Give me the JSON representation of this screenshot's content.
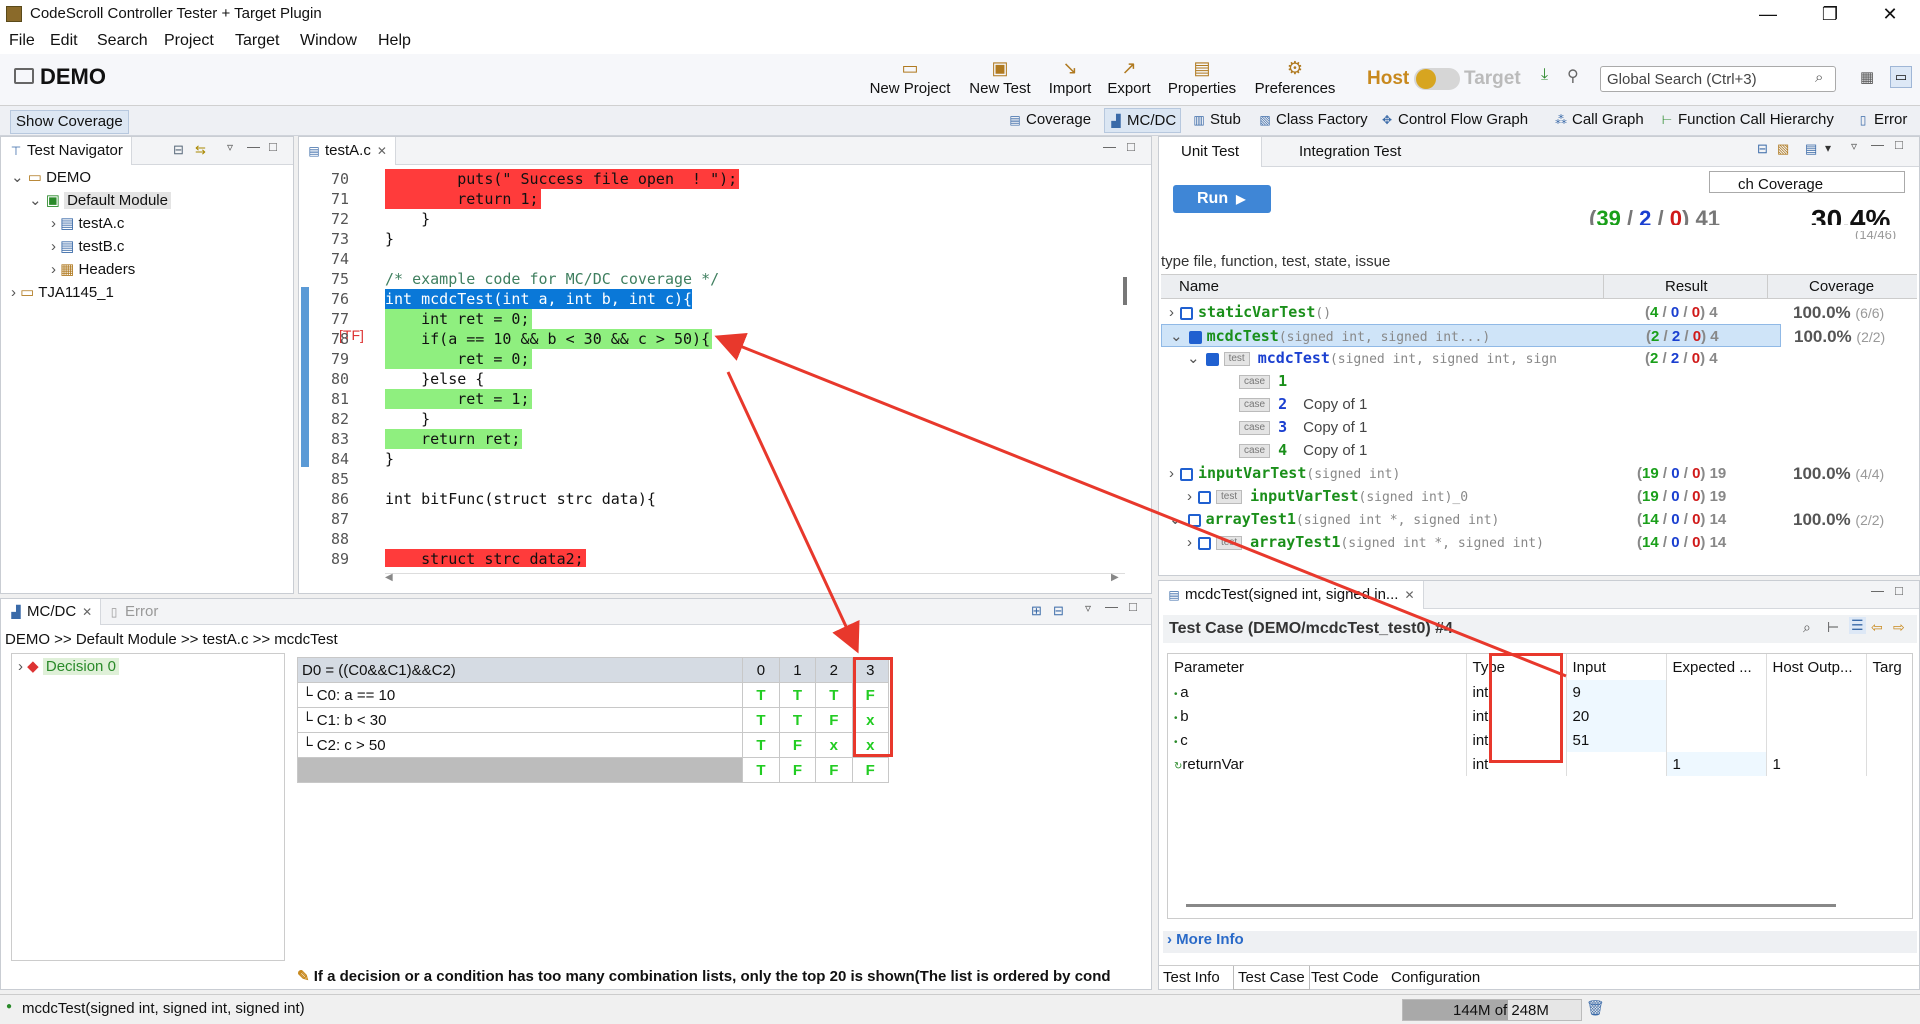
{
  "window": {
    "title": "CodeScroll Controller Tester + Target Plugin",
    "min": "—",
    "max": "❐",
    "close": "✕"
  },
  "menu": [
    "File",
    "Edit",
    "Search",
    "Project",
    "Target",
    "Window",
    "Help"
  ],
  "toolbar": {
    "project": "DEMO",
    "buttons": [
      "New Project",
      "New Test",
      "Import",
      "Export",
      "Properties",
      "Preferences"
    ],
    "host": "Host",
    "target": "Target",
    "search_placeholder": "Global Search (Ctrl+3)"
  },
  "perspective": {
    "show_coverage": "Show Coverage",
    "tabs": [
      "Coverage",
      "MC/DC",
      "Stub",
      "Class Factory",
      "Control Flow Graph",
      "Call Graph",
      "Function Call Hierarchy",
      "Error"
    ]
  },
  "navigator": {
    "title": "Test Navigator",
    "items": [
      "DEMO",
      "Default Module",
      "testA.c",
      "testB.c",
      "Headers",
      "TJA1145_1"
    ]
  },
  "editor": {
    "tab": "testA.c",
    "marker": "[TF]",
    "lines": [
      {
        "n": "70",
        "t": "        puts(\" Success file open  ! \");"
      },
      {
        "n": "71",
        "t": "        return 1;"
      },
      {
        "n": "72",
        "t": "    }"
      },
      {
        "n": "73",
        "t": "}"
      },
      {
        "n": "74",
        "t": ""
      },
      {
        "n": "75",
        "t": "/* example code for MC/DC coverage */"
      },
      {
        "n": "76",
        "t": "int mcdcTest(int a, int b, int c){"
      },
      {
        "n": "77",
        "t": "    int ret = 0;"
      },
      {
        "n": "78",
        "t": "    if(a == 10 && b < 30 && c > 50){"
      },
      {
        "n": "79",
        "t": "        ret = 0;"
      },
      {
        "n": "80",
        "t": "    }else {"
      },
      {
        "n": "81",
        "t": "        ret = 1;"
      },
      {
        "n": "82",
        "t": "    }"
      },
      {
        "n": "83",
        "t": "    return ret;"
      },
      {
        "n": "84",
        "t": "}"
      },
      {
        "n": "85",
        "t": ""
      },
      {
        "n": "86",
        "t": "int bitFunc(struct strc data){"
      },
      {
        "n": "87",
        "t": ""
      },
      {
        "n": "88",
        "t": ""
      },
      {
        "n": "89",
        "t": "    struct strc data2;"
      }
    ]
  },
  "mcdc": {
    "tabs": [
      "MC/DC",
      "Error"
    ],
    "breadcrumb": "DEMO >> Default Module >> testA.c >> mcdcTest",
    "decision": "Decision 0",
    "header": "D0 = ((C0&&C1)&&C2)",
    "cols": [
      "0",
      "1",
      "2",
      "3"
    ],
    "rows": [
      {
        "label": "C0: a == 10",
        "vals": [
          "T",
          "T",
          "T",
          "F"
        ]
      },
      {
        "label": "C1: b < 30",
        "vals": [
          "T",
          "T",
          "F",
          "x"
        ]
      },
      {
        "label": "C2: c > 50",
        "vals": [
          "T",
          "F",
          "x",
          "x"
        ]
      }
    ],
    "result": [
      "T",
      "F",
      "F",
      "F"
    ],
    "note": "If a decision or a condition has too many combination lists, only the top 20 is shown(The list is ordered by cond"
  },
  "unit": {
    "tabs": [
      "Unit Test",
      "Integration Test"
    ],
    "run": "Run",
    "coverage_label": "ch Coverage",
    "summary": {
      "pass": "39",
      "fail": "2",
      "err": "0",
      "total": "41"
    },
    "percent": "30.4%",
    "percent_sub": "(14/46)",
    "filter": "type file, function, test, state, issue",
    "cols": [
      "Name",
      "Result",
      "Coverage"
    ],
    "rows": [
      {
        "kind": "fn",
        "name": "staticVarTest",
        "sig": "()",
        "res": [
          "4",
          "0",
          "0",
          "4"
        ],
        "cov": "100.0%",
        "covsub": "(6/6)"
      },
      {
        "kind": "fn",
        "name": "mcdcTest",
        "sig": "(signed int, signed int...)",
        "res": [
          "2",
          "2",
          "0",
          "4"
        ],
        "cov": "100.0%",
        "covsub": "(2/2)",
        "sel": true
      },
      {
        "kind": "test",
        "name": "mcdcTest",
        "sig": "(signed int, signed int, sign",
        "res": [
          "2",
          "2",
          "0",
          "4"
        ]
      },
      {
        "kind": "case",
        "num": "1",
        "label": ""
      },
      {
        "kind": "case",
        "num": "2",
        "label": "Copy of 1"
      },
      {
        "kind": "case",
        "num": "3",
        "label": "Copy of 1"
      },
      {
        "kind": "case",
        "num": "4",
        "label": "Copy of 1"
      },
      {
        "kind": "fn",
        "name": "inputVarTest",
        "sig": "(signed int)",
        "res": [
          "19",
          "0",
          "0",
          "19"
        ],
        "cov": "100.0%",
        "covsub": "(4/4)"
      },
      {
        "kind": "test",
        "name": "inputVarTest",
        "sig": "(signed int)_0",
        "res": [
          "19",
          "0",
          "0",
          "19"
        ]
      },
      {
        "kind": "fn",
        "name": "arrayTest1",
        "sig": "(signed int *, signed int)",
        "res": [
          "14",
          "0",
          "0",
          "14"
        ],
        "cov": "100.0%",
        "covsub": "(2/2)"
      },
      {
        "kind": "test",
        "name": "arrayTest1",
        "sig": "(signed int *, signed int)",
        "res": [
          "14",
          "0",
          "0",
          "14"
        ]
      }
    ]
  },
  "testcase": {
    "tab": "mcdcTest(signed int, signed in...",
    "title": "Test Case (DEMO/mcdcTest_test0) #4",
    "cols": [
      "Parameter",
      "Type",
      "Input",
      "Expected ...",
      "Host Outp...",
      "Targ"
    ],
    "rows": [
      {
        "p": "a",
        "type": "int",
        "in": "9",
        "exp": "",
        "host": ""
      },
      {
        "p": "b",
        "type": "int",
        "in": "20",
        "exp": "",
        "host": ""
      },
      {
        "p": "c",
        "type": "int",
        "in": "51",
        "exp": "",
        "host": ""
      },
      {
        "p": "returnVar",
        "type": "int",
        "in": "",
        "exp": "1",
        "host": "1"
      }
    ],
    "more": "More Info",
    "bottom_tabs": [
      "Test Info",
      "Test Case",
      "Test Code",
      "Configuration"
    ]
  },
  "status": {
    "left": "mcdcTest(signed int, signed int, signed int)",
    "mem": "144M of 248M"
  },
  "colors": {
    "highlight_red": "#ff3b3b",
    "highlight_green": "#8fef7f",
    "selection": "#0a78d8",
    "annotation": "#e8382c"
  }
}
